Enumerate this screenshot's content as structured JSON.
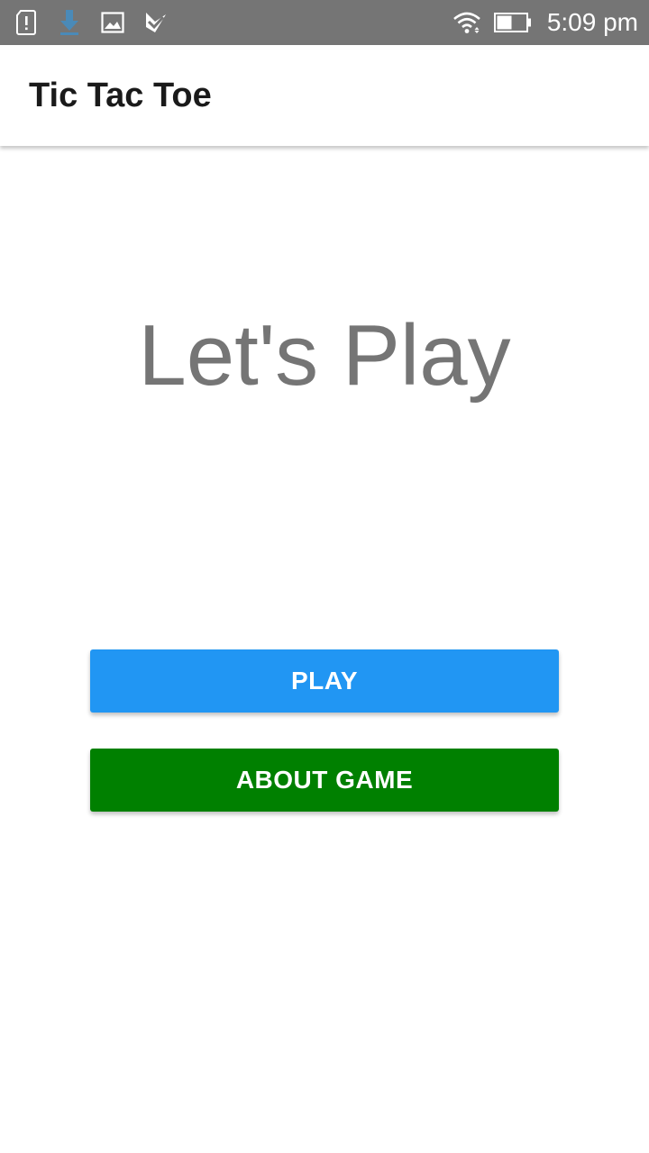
{
  "status_bar": {
    "time": "5:09 pm",
    "icons": [
      "alert-sim-icon",
      "download-icon",
      "image-icon",
      "checkmark-app-icon",
      "wifi-icon",
      "battery-icon"
    ],
    "background": "#757575"
  },
  "app_bar": {
    "title": "Tic Tac Toe"
  },
  "main": {
    "headline": "Let's Play",
    "play_button": {
      "label": "PLAY",
      "color": "#2196f3"
    },
    "about_button": {
      "label": "ABOUT GAME",
      "color": "#008000"
    }
  }
}
